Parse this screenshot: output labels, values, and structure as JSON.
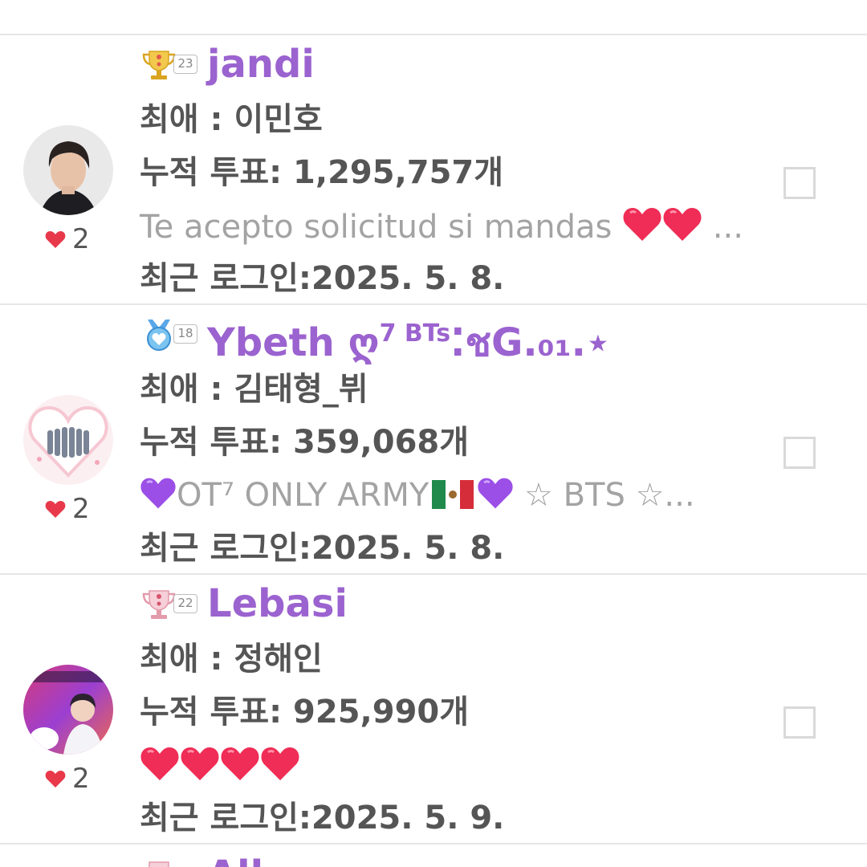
{
  "top_partial": {
    "fragment": ""
  },
  "users": [
    {
      "level": "23",
      "badge_icon": "gold-trophy-icon",
      "name": "jandi",
      "name_suffix": "",
      "name_sup": "",
      "favorite": "최애 : 이민호",
      "votes": "누적 투표: 1,295,757개",
      "message_text": "Te acepto solicitud si mandas",
      "message_tail": "...",
      "last_login": "최근 로그인:2025. 5. 8.",
      "likes": "2"
    },
    {
      "level": "18",
      "badge_icon": "blue-heart-medal-icon",
      "name": "Ybeth ღ",
      "name_sup": "7 BTs",
      "name_suffix": "⁚ชG.₀₁.⋆",
      "favorite": "최애 : 김태형_뷔",
      "votes": "누적 투표: 359,068개",
      "message_text": "OT⁷ ONLY ARMY",
      "message_tail": "☆ BTS ☆...",
      "last_login": "최근 로그인:2025. 5. 8.",
      "likes": "2"
    },
    {
      "level": "22",
      "badge_icon": "pink-trophy-icon",
      "name": "Lebasi",
      "name_sup": "",
      "name_suffix": "",
      "favorite": "최애 : 정해인",
      "votes": "누적 투표: 925,990개",
      "message_text": "",
      "message_tail": "",
      "last_login": "최근 로그인:2025. 5. 9.",
      "likes": "2"
    }
  ],
  "bottom_partial": {
    "name_fragment": "All"
  },
  "colors": {
    "username": "#9b63cf",
    "text": "#555555",
    "message": "#a3a3a3",
    "like_heart": "#e8394a",
    "divider": "#e6e6e6"
  }
}
